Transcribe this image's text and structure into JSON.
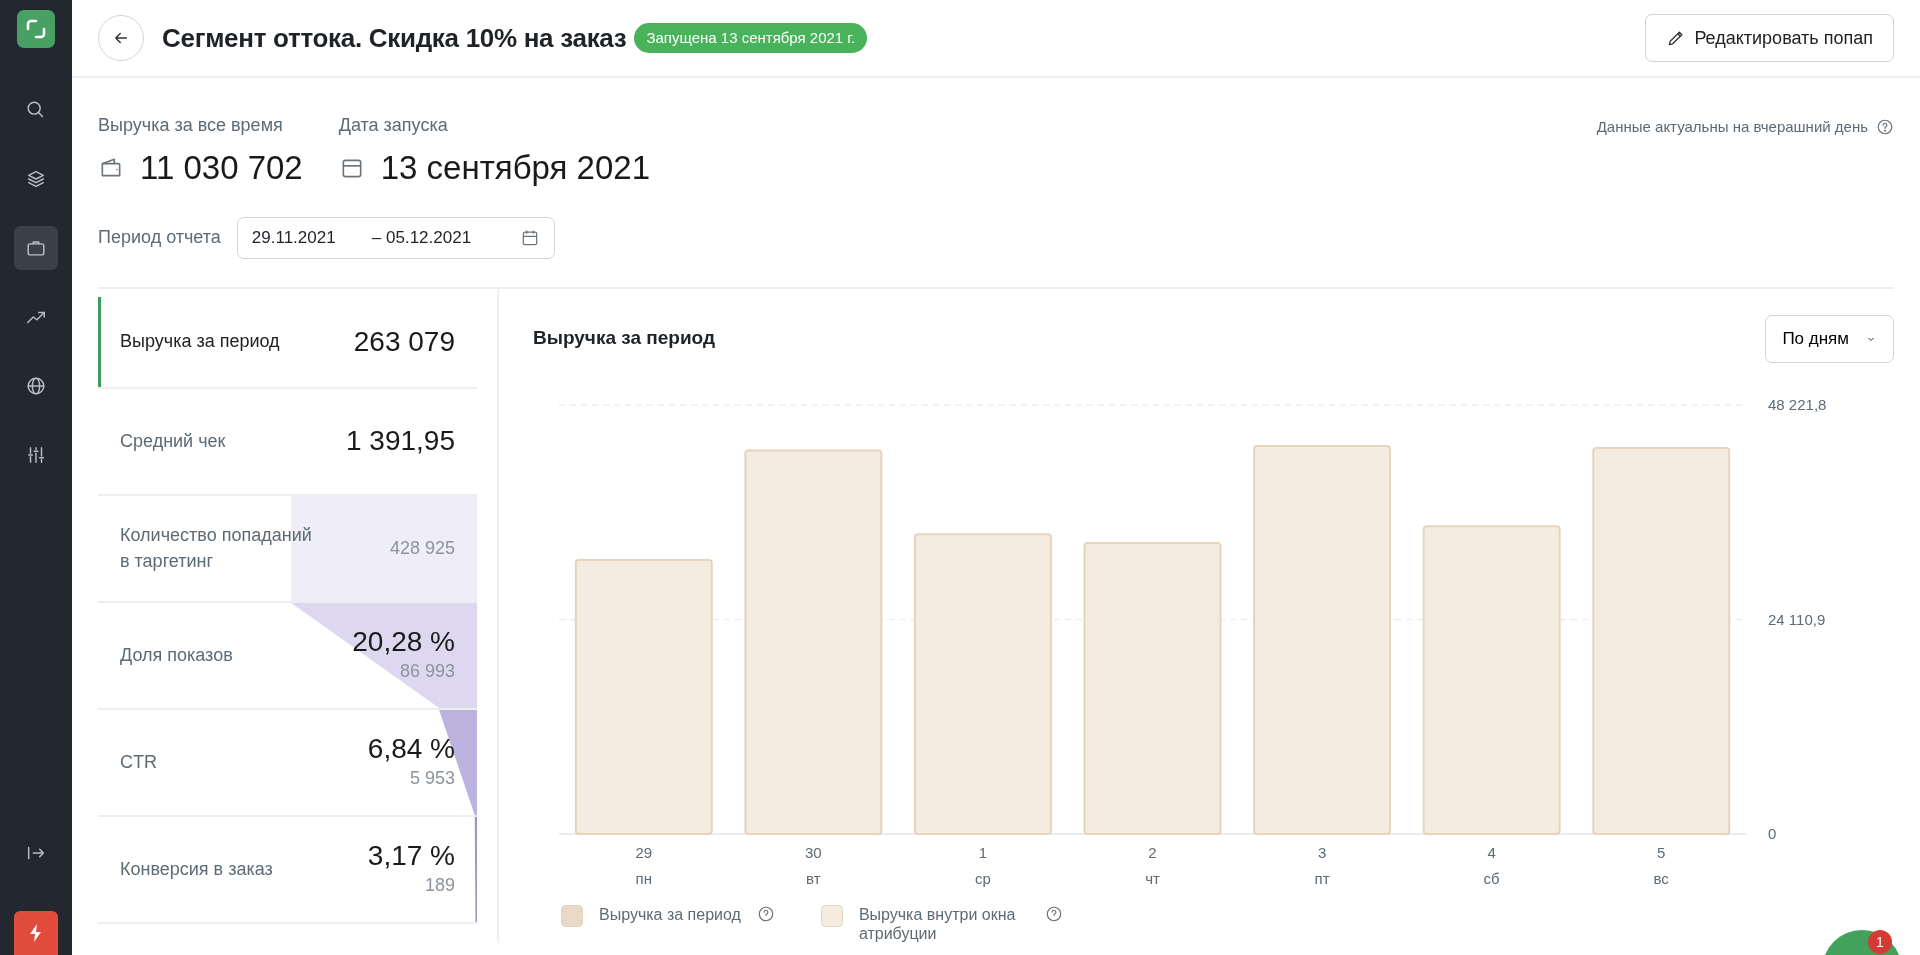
{
  "sidebar": {
    "items": [
      {
        "kind": "search",
        "selected": false
      },
      {
        "kind": "layers",
        "selected": false
      },
      {
        "kind": "briefcase",
        "selected": true
      },
      {
        "kind": "trend",
        "selected": false
      },
      {
        "kind": "globe",
        "selected": false
      },
      {
        "kind": "sliders",
        "selected": false
      }
    ]
  },
  "header": {
    "title": "Сегмент оттока. Скидка 10% на заказ",
    "status": "Запущена 13 сентября 2021 г.",
    "edit_button": "Редактировать попап"
  },
  "summary": [
    {
      "label": "Выручка за все время",
      "value": "11 030 702",
      "kind": "wallet"
    },
    {
      "label": "Дата запуска",
      "value": "13 сентября 2021",
      "kind": "calendar"
    }
  ],
  "freshness_note": "Данные актуальны на вчерашний день",
  "period": {
    "label": "Период отчета",
    "from": "29.11.2021",
    "to": "– 05.12.2021"
  },
  "metrics": [
    {
      "kind": "plain",
      "label": "Выручка за период",
      "value": "263 079",
      "selected": true
    },
    {
      "kind": "plain",
      "label": "Средний чек",
      "value": "1 391,95",
      "selected": false
    },
    {
      "kind": "funnel",
      "label": "Количество попаданий в таргетинг",
      "sub": "428 925",
      "selected": false
    },
    {
      "kind": "funnel",
      "label": "Доля показов",
      "value": "20,28 %",
      "sub": "86 993",
      "selected": false
    },
    {
      "kind": "funnel",
      "label": "CTR",
      "value": "6,84 %",
      "sub": "5 953",
      "selected": false
    },
    {
      "kind": "funnel",
      "label": "Конверсия в заказ",
      "value": "3,17 %",
      "sub": "189",
      "selected": false
    }
  ],
  "chart_panel": {
    "title": "Выручка за период",
    "grouping": "По дням",
    "weekdays": [
      "пн",
      "вт",
      "ср",
      "чт",
      "пт",
      "сб",
      "вс"
    ],
    "chart_data": {
      "type": "bar",
      "categories": [
        "29",
        "30",
        "1",
        "2",
        "3",
        "4",
        "5"
      ],
      "series": [
        {
          "name": "Выручка за период",
          "color": "#e9dac7",
          "values": [
            null,
            null,
            null,
            null,
            null,
            null,
            null
          ]
        },
        {
          "name": "Выручка внутри окна атрибуции",
          "color": "#f4ebe1",
          "values": [
            30800,
            43100,
            33700,
            32700,
            43600,
            34600,
            43400
          ]
        }
      ],
      "ylim": [
        0,
        48221.8
      ],
      "yticks": [
        {
          "value": 0,
          "label": "0"
        },
        {
          "value": 24110.9,
          "label": "24 110,9"
        },
        {
          "value": 48221.8,
          "label": "48 221,8"
        }
      ]
    }
  },
  "chat": {
    "badge": "1"
  }
}
